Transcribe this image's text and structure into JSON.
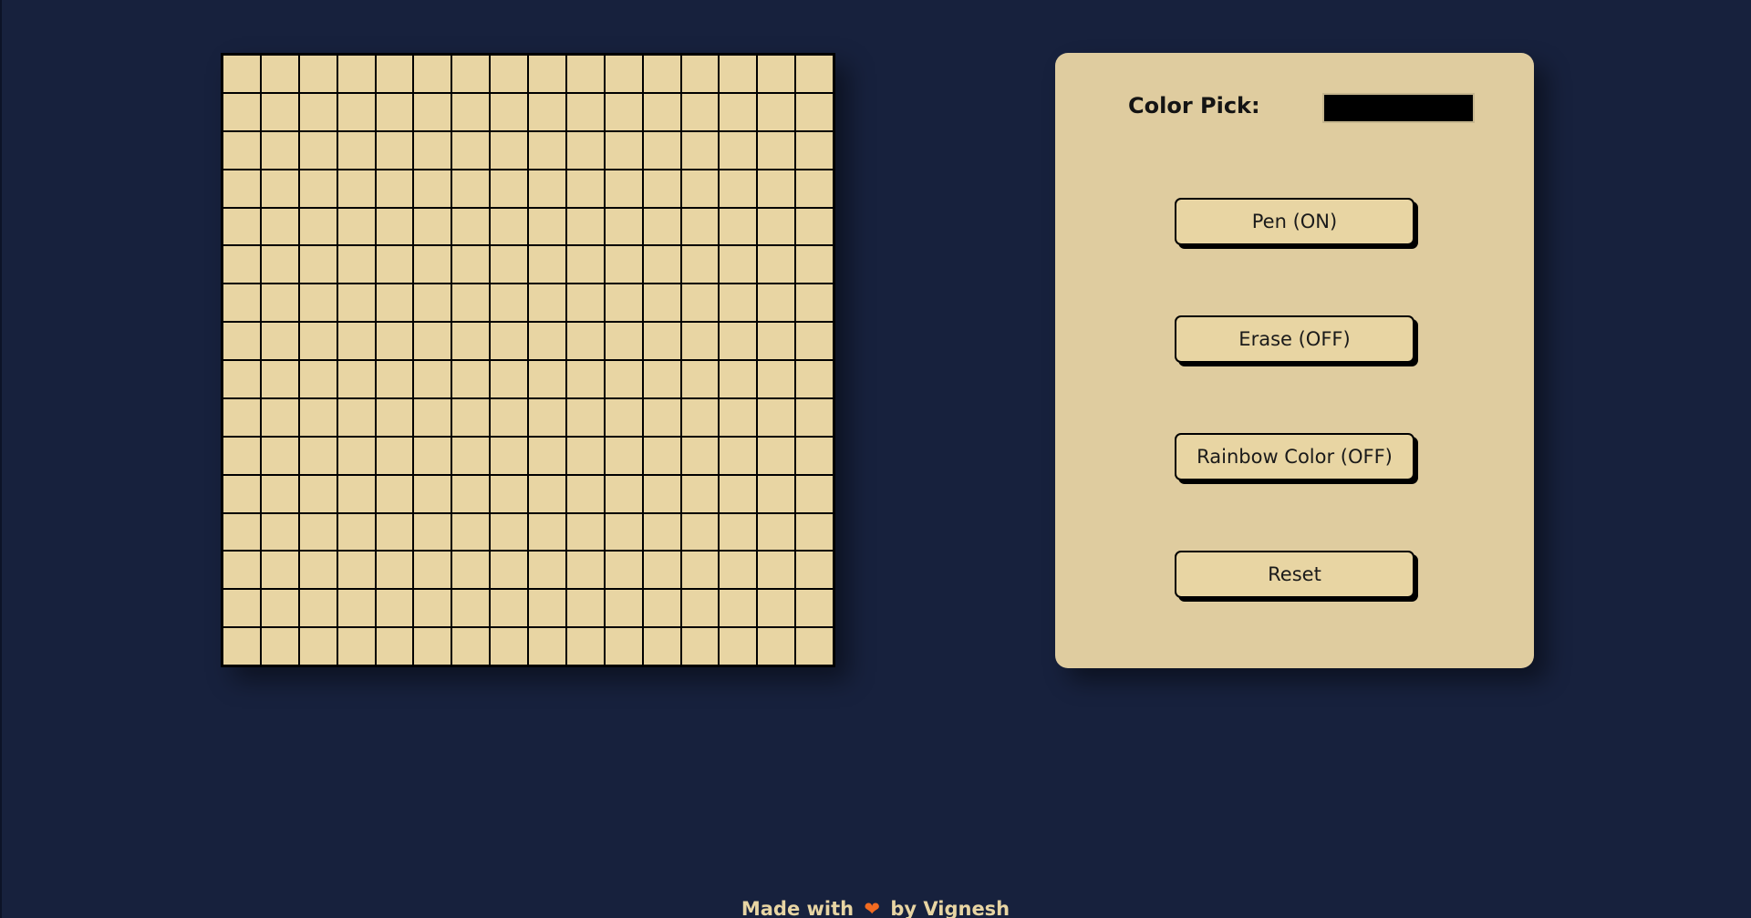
{
  "grid": {
    "rows": 16,
    "columns": 16,
    "cell_color": "#e8d5a3",
    "line_color": "#000000"
  },
  "controls": {
    "color_pick_label": "Color Pick:",
    "color_value": "#000000",
    "pen_button": "Pen (ON)",
    "erase_button": "Erase (OFF)",
    "rainbow_button": "Rainbow Color (OFF)",
    "reset_button": "Reset"
  },
  "footer": {
    "prefix": "Made with",
    "heart_icon": "heart-icon",
    "heart_glyph": "❤",
    "suffix": "by Vignesh"
  },
  "colors": {
    "background": "#17213d",
    "panel": "#dfcc9f",
    "accent": "#f26b21"
  }
}
